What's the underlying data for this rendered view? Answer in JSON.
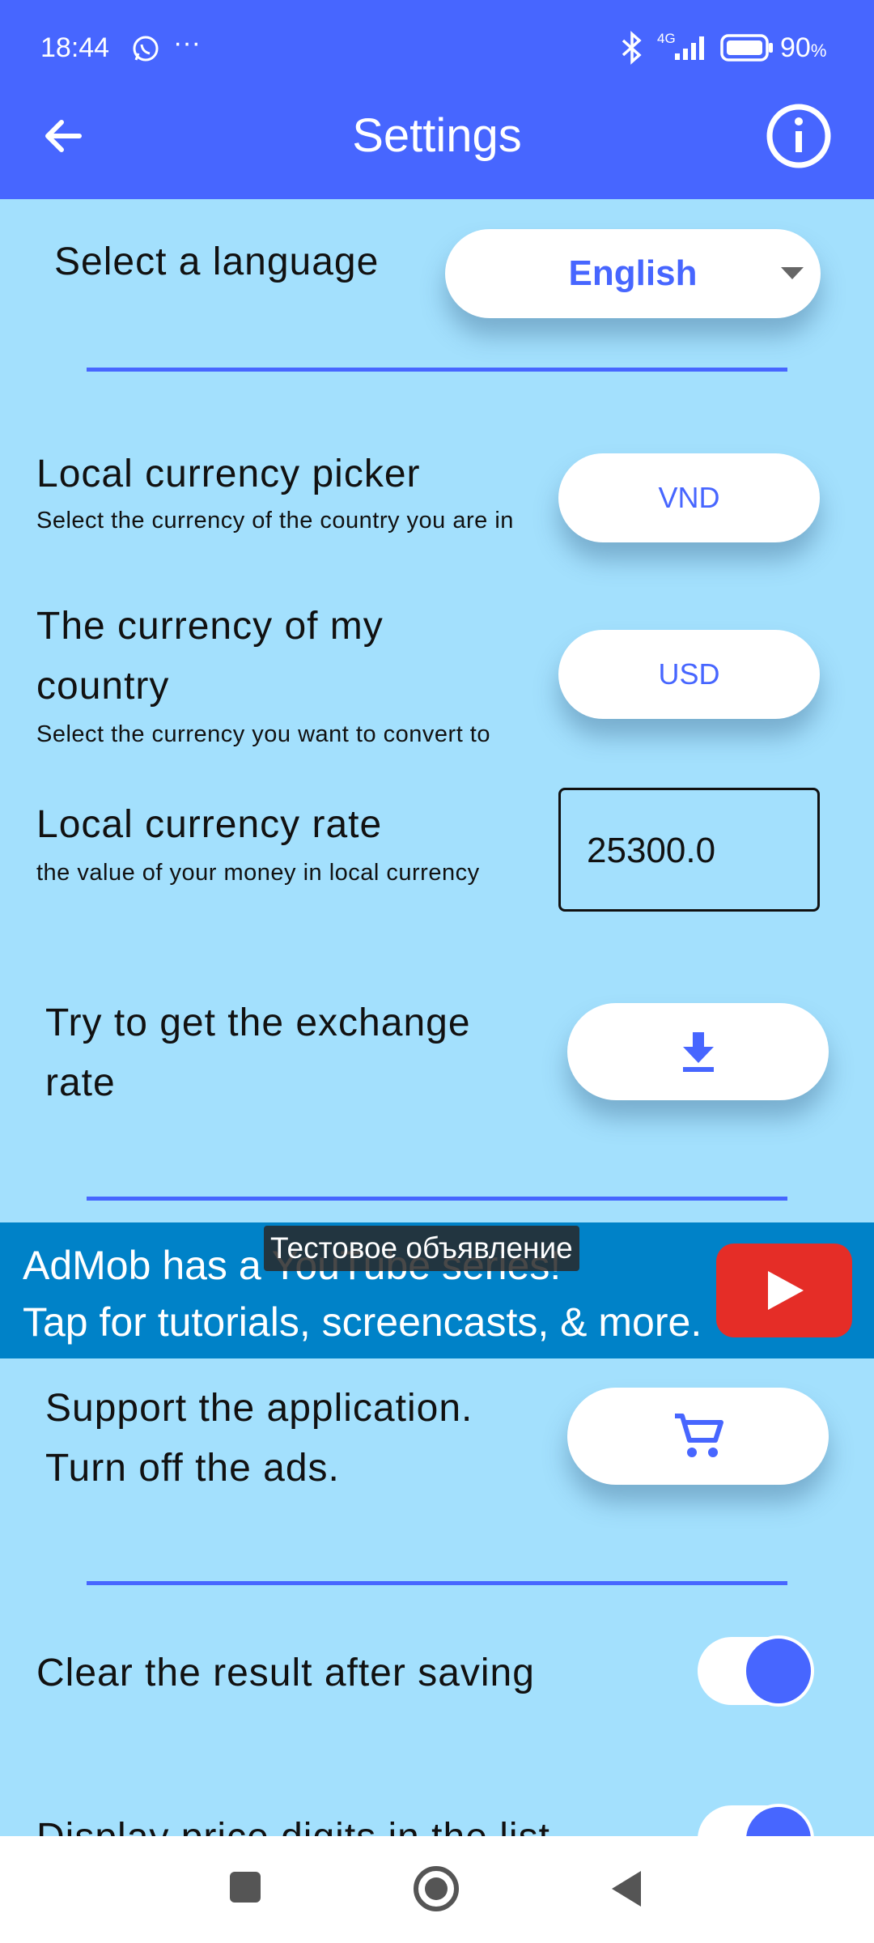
{
  "status_bar": {
    "time": "18:44",
    "more": "···",
    "network": "4G",
    "battery": "90",
    "battery_unit": "%"
  },
  "header": {
    "title": "Settings",
    "back_icon": "arrow-left-icon",
    "info_icon": "info-circle-icon",
    "color": "#4766ff"
  },
  "language": {
    "label": "Select a language",
    "value": "English"
  },
  "local_currency": {
    "title": "Local currency picker",
    "subtitle": "Select the currency of the country you are in",
    "value": "VND"
  },
  "my_currency": {
    "title_line1": "The currency of my",
    "title_line2": "country",
    "subtitle": "Select the currency you want to convert to",
    "value": "USD"
  },
  "rate": {
    "title": "Local currency rate",
    "subtitle": "the value of your money in local currency",
    "value": "25300.0"
  },
  "exchange": {
    "line1": "Try to get the exchange",
    "line2": "rate",
    "icon": "download-icon"
  },
  "ad": {
    "badge": "Тестовое объявление",
    "line1": "AdMob has a YouTube series!",
    "line2": "Tap for tutorials, screencasts, & more.",
    "icon": "youtube-play-icon",
    "background": "#0082c8"
  },
  "support": {
    "line1": "Support the application.",
    "line2": "Turn off the ads.",
    "icon": "cart-icon"
  },
  "clear_result": {
    "label": "Clear the result after saving",
    "enabled": true
  },
  "display_digits": {
    "label": "Display price digits in the list",
    "enabled": true
  },
  "nav_bar": {
    "recents_icon": "square-icon",
    "home_icon": "home-circle-icon",
    "back_icon": "triangle-back-icon"
  }
}
